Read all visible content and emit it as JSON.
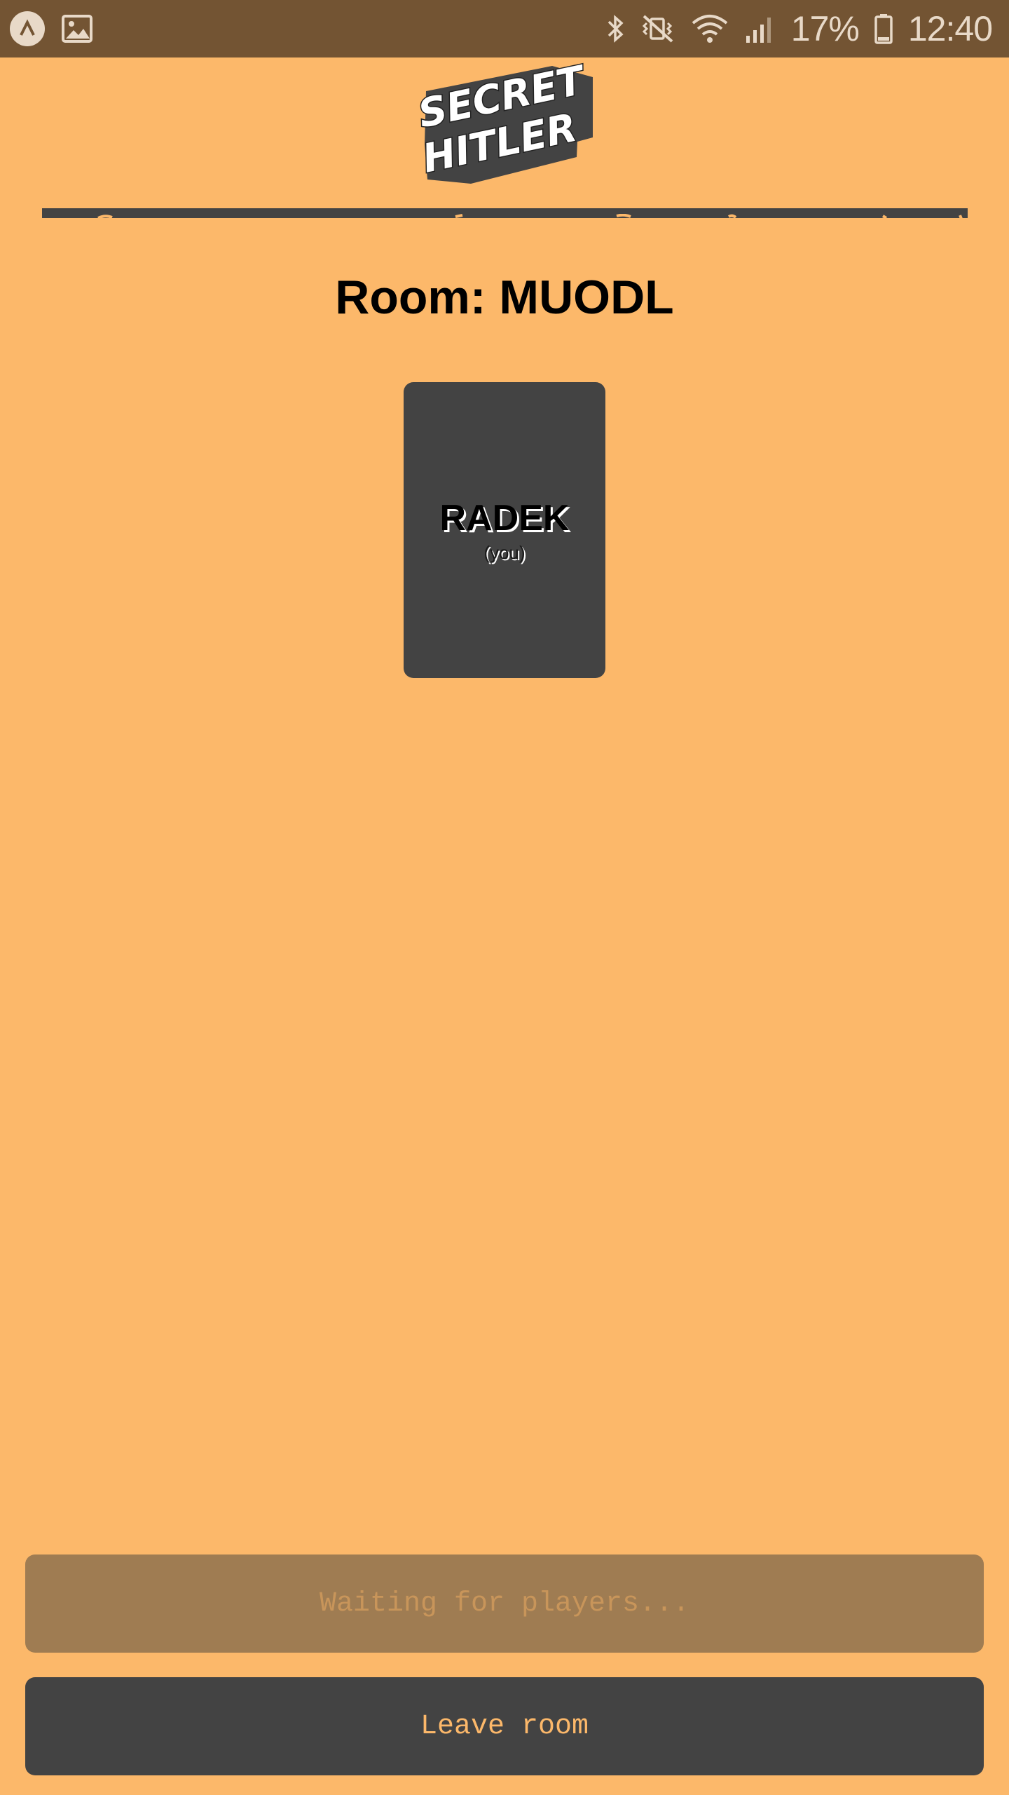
{
  "status_bar": {
    "left_icons": [
      "app-notification-icon",
      "image-icon"
    ],
    "right_icons": [
      "bluetooth-icon",
      "vibrate-mute-icon",
      "wifi-icon",
      "signal-icon",
      "battery-icon"
    ],
    "battery_percent": "17%",
    "time": "12:40"
  },
  "logo": {
    "line1": "SECRET",
    "line2": "HITLER"
  },
  "room": {
    "title": "Room: MUODL"
  },
  "players": [
    {
      "name": "RADEK",
      "tag": "(you)"
    }
  ],
  "buttons": {
    "waiting_label": "Waiting for players...",
    "leave_label": "Leave room"
  },
  "colors": {
    "background": "#FCB86A",
    "status_bar": "#735433",
    "dark": "#434343",
    "waiting_button": "#9F7C52"
  }
}
